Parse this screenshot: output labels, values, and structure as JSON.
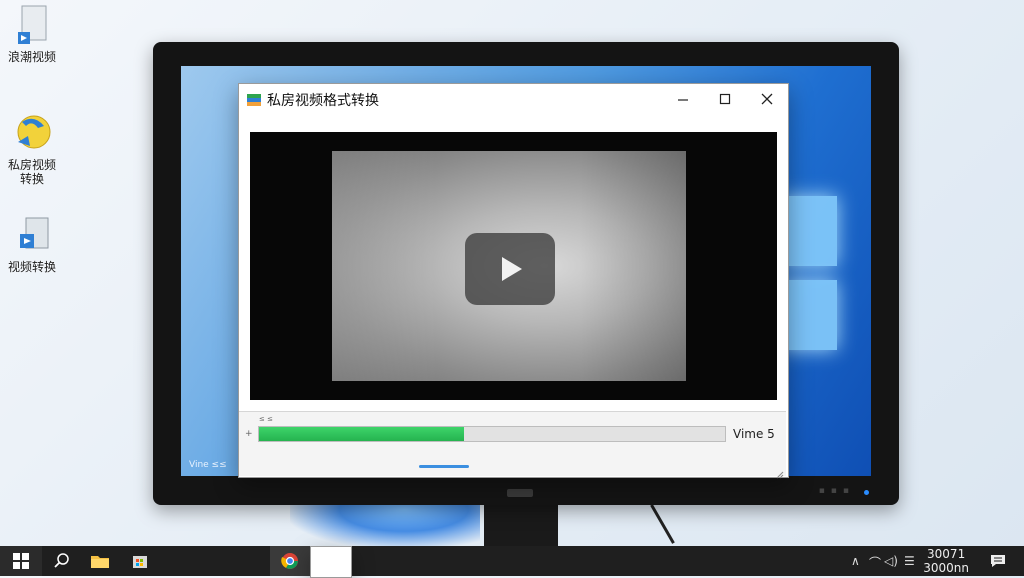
{
  "desktop": {
    "icons": [
      {
        "label": "浪潮视频"
      },
      {
        "label": "私房视频\n转换"
      },
      {
        "label": "视频转换"
      }
    ]
  },
  "app": {
    "title": "私房视频格式转换",
    "progress": {
      "fraction": 0.44,
      "label": "Vime 5"
    },
    "tiny_top_text": "≤ ≤",
    "arrow_text": "+"
  },
  "screen": {
    "bottom_text": "Vine ≤≤"
  },
  "taskbar": {
    "clock_time": "30071",
    "clock_date": "3000nn"
  },
  "colors": {
    "progress": "#2fc35a",
    "taskbar": "#1f1f1f",
    "screen_blue": "#1f6fd1"
  }
}
